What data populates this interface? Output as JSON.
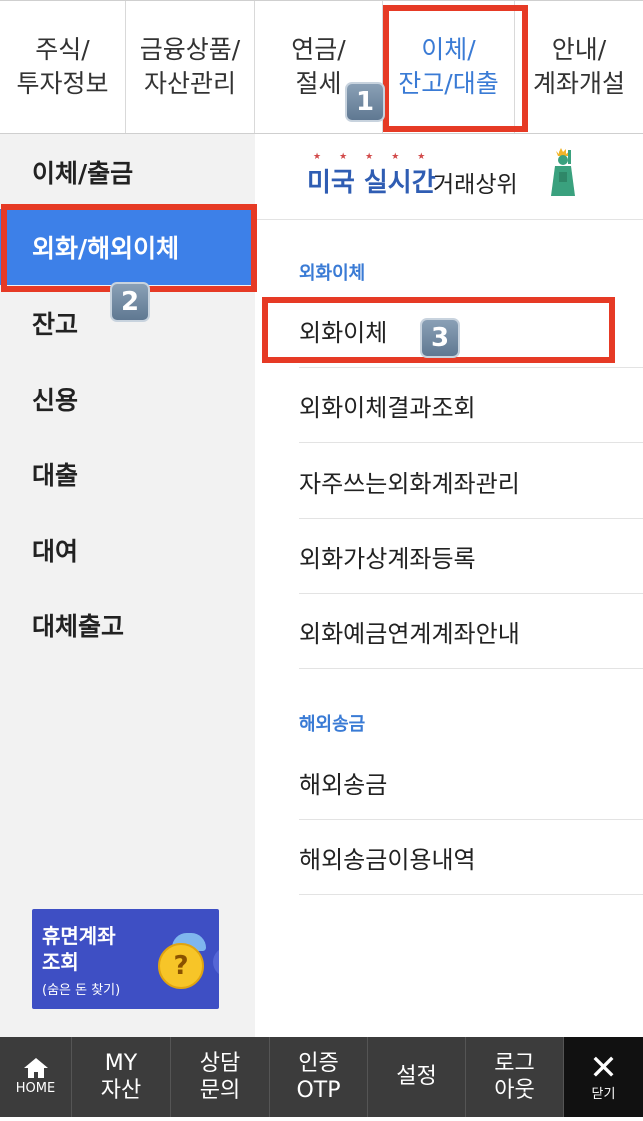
{
  "top_tabs": [
    {
      "line1": "주식/",
      "line2": "투자정보"
    },
    {
      "line1": "금융상품/",
      "line2": "자산관리"
    },
    {
      "line1": "연금/",
      "line2": "절세"
    },
    {
      "line1": "이체/",
      "line2": "잔고/대출"
    },
    {
      "line1": "안내/",
      "line2": "계좌개설"
    }
  ],
  "active_tab_color": "#3a7bd5",
  "sidebar": {
    "items": [
      {
        "label": "이체/출금"
      },
      {
        "label": "외화/해외이체"
      },
      {
        "label": "잔고"
      },
      {
        "label": "신용"
      },
      {
        "label": "대출"
      },
      {
        "label": "대여"
      },
      {
        "label": "대체출고"
      }
    ],
    "active_color": "#3d80e8",
    "banner": {
      "line1": "휴면계좌",
      "line2": "조회",
      "sub": "(숨은 돈 찾기)",
      "coin": "?",
      "arrow": "›"
    }
  },
  "promo": {
    "highlight": "미국 실시간",
    "text": "거래상위",
    "stars": "★★★★★"
  },
  "sections": [
    {
      "title": "외화이체",
      "items": [
        "외화이체",
        "외화이체결과조회",
        "자주쓰는외화계좌관리",
        "외화가상계좌등록",
        "외화예금연계계좌안내"
      ]
    },
    {
      "title": "해외송금",
      "items": [
        "해외송금",
        "해외송금이용내역"
      ]
    }
  ],
  "annotations": {
    "badge1": "1",
    "badge2": "2",
    "badge3": "3",
    "color": "#e63a25"
  },
  "bottom_bar": {
    "home": {
      "icon": "home-icon",
      "label": "HOME"
    },
    "items": [
      {
        "line1": "MY",
        "line2": "자산"
      },
      {
        "line1": "상담",
        "line2": "문의"
      },
      {
        "line1": "인증",
        "line2": "OTP"
      },
      {
        "line1": "설정",
        "line2": ""
      },
      {
        "line1": "로그",
        "line2": "아웃"
      }
    ],
    "close": {
      "icon": "close-icon",
      "symbol": "✕",
      "label": "닫기"
    }
  }
}
